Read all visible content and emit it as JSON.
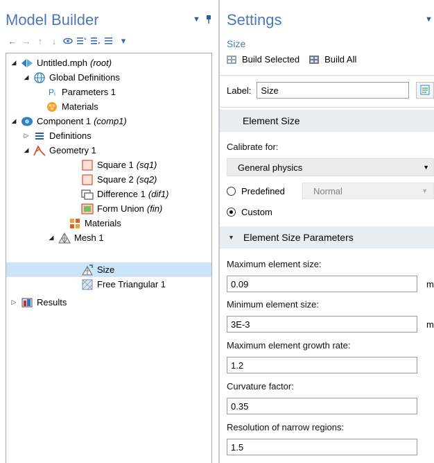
{
  "left_panel": {
    "title": "Model Builder",
    "menu_glyph": "▼",
    "pin_glyph": "📌",
    "toolbar": [
      "←",
      "→",
      "↑",
      "↓",
      "👁",
      "≣",
      "≣",
      "≣",
      "▾"
    ],
    "tree": [
      {
        "label": "Untitled.mph",
        "suffix": "(root)",
        "toggle": "◢",
        "icon": "mph-icon"
      },
      {
        "label": "Global Definitions",
        "suffix": "",
        "toggle": "◢",
        "icon": "globe-icon"
      },
      {
        "label": "Parameters 1",
        "suffix": "",
        "toggle": "",
        "icon": "parameters-icon",
        "icon_text": "Pᵢ"
      },
      {
        "label": "Materials",
        "suffix": "",
        "toggle": "",
        "icon": "materials-icon"
      },
      {
        "label": "Component 1",
        "suffix": "(comp1)",
        "toggle": "◢",
        "icon": "component-icon"
      },
      {
        "label": "Definitions",
        "suffix": "",
        "toggle": "▷",
        "icon": "definitions-icon"
      },
      {
        "label": "Geometry 1",
        "suffix": "",
        "toggle": "◢",
        "icon": "geometry-icon"
      },
      {
        "label": "Square 1",
        "suffix": "(sq1)",
        "toggle": "",
        "icon": "square-icon"
      },
      {
        "label": "Square 2",
        "suffix": "(sq2)",
        "toggle": "",
        "icon": "square-icon"
      },
      {
        "label": "Difference 1",
        "suffix": "(dif1)",
        "toggle": "",
        "icon": "difference-icon"
      },
      {
        "label": "Form Union",
        "suffix": "(fin)",
        "toggle": "",
        "icon": "form-union-icon"
      },
      {
        "label": "Materials",
        "suffix": "",
        "toggle": "",
        "icon": "materials-grid-icon"
      },
      {
        "label": "Mesh 1",
        "suffix": "",
        "toggle": "◢",
        "icon": "mesh-icon"
      },
      {
        "label": "Size",
        "suffix": "",
        "toggle": "",
        "icon": "size-icon"
      },
      {
        "label": "Free Triangular 1",
        "suffix": "",
        "toggle": "",
        "icon": "free-triangular-icon"
      },
      {
        "label": "Results",
        "suffix": "",
        "toggle": "▷",
        "icon": "results-icon"
      }
    ]
  },
  "right_panel": {
    "title": "Settings",
    "menu_glyph": "▼",
    "subtitle": "Size",
    "build_selected": "Build Selected",
    "build_all": "Build All",
    "label_text": "Label:",
    "label_value": "Size",
    "section_element_size": "Element Size",
    "calibrate_label": "Calibrate for:",
    "calibrate_value": "General physics",
    "dropdown_arrow": "▼",
    "predefined_label": "Predefined",
    "predefined_value": "Normal",
    "custom_label": "Custom",
    "section_params": "Element Size Parameters",
    "section_chevron": "▼",
    "params": [
      {
        "label": "Maximum element size:",
        "value": "0.09",
        "unit": "m"
      },
      {
        "label": "Minimum element size:",
        "value": "3E-3",
        "unit": "m"
      },
      {
        "label": "Maximum element growth rate:",
        "value": "1.2",
        "unit": ""
      },
      {
        "label": "Curvature factor:",
        "value": "0.35",
        "unit": ""
      },
      {
        "label": "Resolution of narrow regions:",
        "value": "1.5",
        "unit": ""
      }
    ]
  },
  "colors": {
    "title_blue": "#4a78b8",
    "selection": "#cce4f7",
    "section_bg": "#e8ecf3"
  }
}
